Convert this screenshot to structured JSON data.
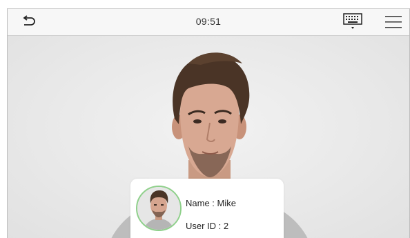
{
  "topbar": {
    "time": "09:51",
    "back_icon": "back-arrow-icon",
    "keyboard_icon": "keyboard-icon",
    "menu_icon": "hamburger-menu-icon"
  },
  "recognition": {
    "name_label": "Name",
    "name_value": "Mike",
    "name_line": "Name : Mike",
    "user_id_label": "User ID",
    "user_id_value": "2",
    "user_id_line": "User ID : 2"
  },
  "colors": {
    "avatar_ring": "#8fd08b",
    "topbar_bg": "#f7f7f7",
    "camera_bg": "#ececec"
  }
}
